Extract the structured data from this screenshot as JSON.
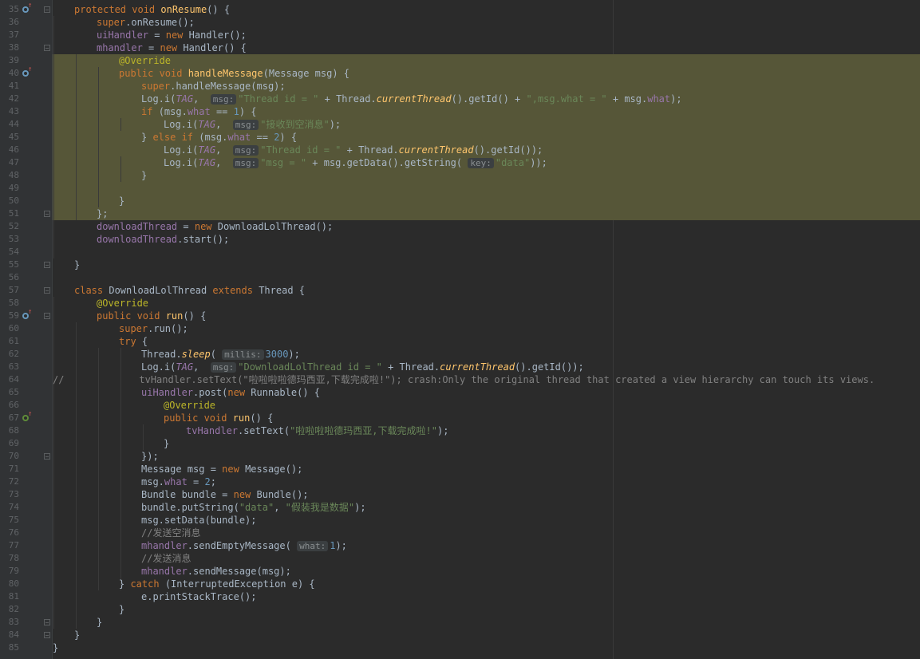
{
  "editor": {
    "lines": [
      {
        "n": "35",
        "icon": "override-blue",
        "fold": true,
        "indent": 1,
        "t": [
          [
            "kw",
            "protected void "
          ],
          [
            "fn",
            "onResume"
          ],
          [
            "p",
            "() {"
          ]
        ]
      },
      {
        "n": "36",
        "indent": 2,
        "t": [
          [
            "kw",
            "super"
          ],
          [
            "p",
            "."
          ],
          [
            "p",
            "onResume"
          ],
          [
            "p",
            "();"
          ]
        ]
      },
      {
        "n": "37",
        "indent": 2,
        "t": [
          [
            "fld",
            "uiHandler"
          ],
          [
            "p",
            " = "
          ],
          [
            "kw",
            "new "
          ],
          [
            "p",
            "Handler();"
          ]
        ]
      },
      {
        "n": "38",
        "fold": true,
        "indent": 2,
        "t": [
          [
            "fld",
            "mhandler"
          ],
          [
            "p",
            " = "
          ],
          [
            "kw",
            "new "
          ],
          [
            "p",
            "Handler() {"
          ]
        ]
      },
      {
        "n": "39",
        "hl": true,
        "indent": 3,
        "t": [
          [
            "ann",
            "@Override"
          ]
        ]
      },
      {
        "n": "40",
        "hl": true,
        "icon": "override-blue",
        "indent": 3,
        "t": [
          [
            "kw",
            "public void "
          ],
          [
            "fn",
            "handleMessage"
          ],
          [
            "p",
            "(Message msg) {"
          ]
        ]
      },
      {
        "n": "41",
        "hl": true,
        "indent": 4,
        "t": [
          [
            "kw",
            "super"
          ],
          [
            "p",
            ".handleMessage(msg);"
          ]
        ]
      },
      {
        "n": "42",
        "hl": true,
        "indent": 4,
        "t": [
          [
            "p",
            "Log."
          ],
          [
            "p",
            "i"
          ],
          [
            "p",
            "("
          ],
          [
            "fldi",
            "TAG"
          ],
          [
            "p",
            ",  "
          ],
          [
            "hint",
            "msg:"
          ],
          [
            "str",
            "\"Thread id = \""
          ],
          [
            "p",
            " + Thread."
          ],
          [
            "fldi2",
            "currentThread"
          ],
          [
            "p",
            "().getId() + "
          ],
          [
            "str",
            "\",msg.what = \""
          ],
          [
            "p",
            " + msg."
          ],
          [
            "fld",
            "what"
          ],
          [
            "p",
            ");"
          ]
        ]
      },
      {
        "n": "43",
        "hl": true,
        "indent": 4,
        "t": [
          [
            "kw",
            "if "
          ],
          [
            "p",
            "(msg."
          ],
          [
            "fld",
            "what"
          ],
          [
            "p",
            " == "
          ],
          [
            "num",
            "1"
          ],
          [
            "p",
            ") {"
          ]
        ]
      },
      {
        "n": "44",
        "hl": true,
        "indent": 5,
        "t": [
          [
            "p",
            "Log."
          ],
          [
            "p",
            "i"
          ],
          [
            "p",
            "("
          ],
          [
            "fldi",
            "TAG"
          ],
          [
            "p",
            ",  "
          ],
          [
            "hint",
            "msg:"
          ],
          [
            "str",
            "\"接收到空消息\""
          ],
          [
            "p",
            ");"
          ]
        ]
      },
      {
        "n": "45",
        "hl": true,
        "indent": 4,
        "t": [
          [
            "p",
            "} "
          ],
          [
            "kw",
            "else if "
          ],
          [
            "p",
            "(msg."
          ],
          [
            "fld",
            "what"
          ],
          [
            "p",
            " == "
          ],
          [
            "num",
            "2"
          ],
          [
            "p",
            ") {"
          ]
        ]
      },
      {
        "n": "46",
        "hl": true,
        "indent": 5,
        "t": [
          [
            "p",
            "Log."
          ],
          [
            "p",
            "i"
          ],
          [
            "p",
            "("
          ],
          [
            "fldi",
            "TAG"
          ],
          [
            "p",
            ",  "
          ],
          [
            "hint",
            "msg:"
          ],
          [
            "str",
            "\"Thread id = \""
          ],
          [
            "p",
            " + Thread."
          ],
          [
            "fldi2",
            "currentThread"
          ],
          [
            "p",
            "().getId());"
          ]
        ]
      },
      {
        "n": "47",
        "hl": true,
        "indent": 5,
        "t": [
          [
            "p",
            "Log."
          ],
          [
            "p",
            "i"
          ],
          [
            "p",
            "("
          ],
          [
            "fldi",
            "TAG"
          ],
          [
            "p",
            ",  "
          ],
          [
            "hint",
            "msg:"
          ],
          [
            "str",
            "\"msg = \""
          ],
          [
            "p",
            " + msg.getData().getString( "
          ],
          [
            "hint",
            "key:"
          ],
          [
            "str",
            "\"data\""
          ],
          [
            "p",
            "));"
          ]
        ]
      },
      {
        "n": "48",
        "hl": true,
        "indent": 4,
        "t": [
          [
            "p",
            "}"
          ]
        ]
      },
      {
        "n": "49",
        "hl": true,
        "indent": 0,
        "t": []
      },
      {
        "n": "50",
        "hl": true,
        "indent": 3,
        "t": [
          [
            "p",
            "}"
          ]
        ]
      },
      {
        "n": "51",
        "hl": true,
        "fold": true,
        "indent": 2,
        "t": [
          [
            "p",
            "};"
          ]
        ]
      },
      {
        "n": "52",
        "indent": 2,
        "t": [
          [
            "fld",
            "downloadThread"
          ],
          [
            "p",
            " = "
          ],
          [
            "kw",
            "new "
          ],
          [
            "p",
            "DownloadLolThread();"
          ]
        ]
      },
      {
        "n": "53",
        "indent": 2,
        "t": [
          [
            "fld",
            "downloadThread"
          ],
          [
            "p",
            ".start();"
          ]
        ]
      },
      {
        "n": "54",
        "indent": 0,
        "t": []
      },
      {
        "n": "55",
        "fold": true,
        "indent": 1,
        "t": [
          [
            "p",
            "}"
          ]
        ]
      },
      {
        "n": "56",
        "indent": 0,
        "t": []
      },
      {
        "n": "57",
        "fold": true,
        "indent": 1,
        "t": [
          [
            "kw",
            "class "
          ],
          [
            "p",
            "DownloadLolThread "
          ],
          [
            "kw",
            "extends "
          ],
          [
            "p",
            "Thread {"
          ]
        ]
      },
      {
        "n": "58",
        "indent": 2,
        "t": [
          [
            "ann",
            "@Override"
          ]
        ]
      },
      {
        "n": "59",
        "icon": "override-blue",
        "fold": true,
        "indent": 2,
        "t": [
          [
            "kw",
            "public void "
          ],
          [
            "fn",
            "run"
          ],
          [
            "p",
            "() {"
          ]
        ]
      },
      {
        "n": "60",
        "indent": 3,
        "t": [
          [
            "kw",
            "super"
          ],
          [
            "p",
            ".run();"
          ]
        ]
      },
      {
        "n": "61",
        "indent": 3,
        "t": [
          [
            "kw",
            "try "
          ],
          [
            "p",
            "{"
          ]
        ]
      },
      {
        "n": "62",
        "indent": 4,
        "t": [
          [
            "p",
            "Thread."
          ],
          [
            "fldi2",
            "sleep"
          ],
          [
            "p",
            "( "
          ],
          [
            "hint",
            "millis:"
          ],
          [
            "num",
            "3000"
          ],
          [
            "p",
            ");"
          ]
        ]
      },
      {
        "n": "63",
        "indent": 4,
        "t": [
          [
            "p",
            "Log."
          ],
          [
            "p",
            "i"
          ],
          [
            "p",
            "("
          ],
          [
            "fldi",
            "TAG"
          ],
          [
            "p",
            ",  "
          ],
          [
            "hint",
            "msg:"
          ],
          [
            "str",
            "\"DownloadLolThread id = \""
          ],
          [
            "p",
            " + Thread."
          ],
          [
            "fldi2",
            "currentThread"
          ],
          [
            "p",
            "().getId());"
          ]
        ]
      },
      {
        "n": "64",
        "indent": 0,
        "t": [
          [
            "cmt",
            "//             tvHandler.setText(\"啦啦啦啦德玛西亚,下载完成啦!\"); crash:Only the original thread that created a view hierarchy can touch its views."
          ]
        ]
      },
      {
        "n": "65",
        "indent": 4,
        "t": [
          [
            "fld",
            "uiHandler"
          ],
          [
            "p",
            ".post("
          ],
          [
            "kw",
            "new "
          ],
          [
            "p",
            "Runnable() {"
          ]
        ]
      },
      {
        "n": "66",
        "indent": 5,
        "t": [
          [
            "ann",
            "@Override"
          ]
        ]
      },
      {
        "n": "67",
        "icon": "override-green",
        "indent": 5,
        "t": [
          [
            "kw",
            "public void "
          ],
          [
            "fn",
            "run"
          ],
          [
            "p",
            "() {"
          ]
        ]
      },
      {
        "n": "68",
        "indent": 6,
        "t": [
          [
            "fld",
            "tvHandler"
          ],
          [
            "p",
            ".setText("
          ],
          [
            "str",
            "\"啦啦啦啦德玛西亚,下载完成啦!\""
          ],
          [
            "p",
            ");"
          ]
        ]
      },
      {
        "n": "69",
        "indent": 5,
        "t": [
          [
            "p",
            "}"
          ]
        ]
      },
      {
        "n": "70",
        "fold": true,
        "indent": 4,
        "t": [
          [
            "p",
            "});"
          ]
        ]
      },
      {
        "n": "71",
        "indent": 4,
        "t": [
          [
            "p",
            "Message msg = "
          ],
          [
            "kw",
            "new "
          ],
          [
            "p",
            "Message();"
          ]
        ]
      },
      {
        "n": "72",
        "indent": 4,
        "t": [
          [
            "p",
            "msg."
          ],
          [
            "fld",
            "what"
          ],
          [
            "p",
            " = "
          ],
          [
            "num",
            "2"
          ],
          [
            "p",
            ";"
          ]
        ]
      },
      {
        "n": "73",
        "indent": 4,
        "t": [
          [
            "p",
            "Bundle bundle = "
          ],
          [
            "kw",
            "new "
          ],
          [
            "p",
            "Bundle();"
          ]
        ]
      },
      {
        "n": "74",
        "indent": 4,
        "t": [
          [
            "p",
            "bundle.putString("
          ],
          [
            "str",
            "\"data\""
          ],
          [
            "p",
            ", "
          ],
          [
            "str",
            "\"假装我是数据\""
          ],
          [
            "p",
            ");"
          ]
        ]
      },
      {
        "n": "75",
        "indent": 4,
        "t": [
          [
            "p",
            "msg.setData(bundle);"
          ]
        ]
      },
      {
        "n": "76",
        "indent": 4,
        "t": [
          [
            "cmt",
            "//发送空消息"
          ]
        ]
      },
      {
        "n": "77",
        "indent": 4,
        "t": [
          [
            "fld",
            "mhandler"
          ],
          [
            "p",
            ".sendEmptyMessage( "
          ],
          [
            "hint",
            "what:"
          ],
          [
            "num",
            "1"
          ],
          [
            "p",
            ");"
          ]
        ]
      },
      {
        "n": "78",
        "indent": 4,
        "t": [
          [
            "cmt",
            "//发送消息"
          ]
        ]
      },
      {
        "n": "79",
        "indent": 4,
        "t": [
          [
            "fld",
            "mhandler"
          ],
          [
            "p",
            ".sendMessage(msg);"
          ]
        ]
      },
      {
        "n": "80",
        "indent": 3,
        "t": [
          [
            "p",
            "} "
          ],
          [
            "kw",
            "catch "
          ],
          [
            "p",
            "(InterruptedException e) {"
          ]
        ]
      },
      {
        "n": "81",
        "indent": 4,
        "t": [
          [
            "p",
            "e.printStackTrace();"
          ]
        ]
      },
      {
        "n": "82",
        "indent": 3,
        "t": [
          [
            "p",
            "}"
          ]
        ]
      },
      {
        "n": "83",
        "fold": true,
        "indent": 2,
        "t": [
          [
            "p",
            "}"
          ]
        ]
      },
      {
        "n": "84",
        "fold": true,
        "indent": 1,
        "t": [
          [
            "p",
            "}"
          ]
        ]
      },
      {
        "n": "85",
        "indent": 0,
        "t": [
          [
            "p",
            "}"
          ]
        ]
      }
    ]
  }
}
